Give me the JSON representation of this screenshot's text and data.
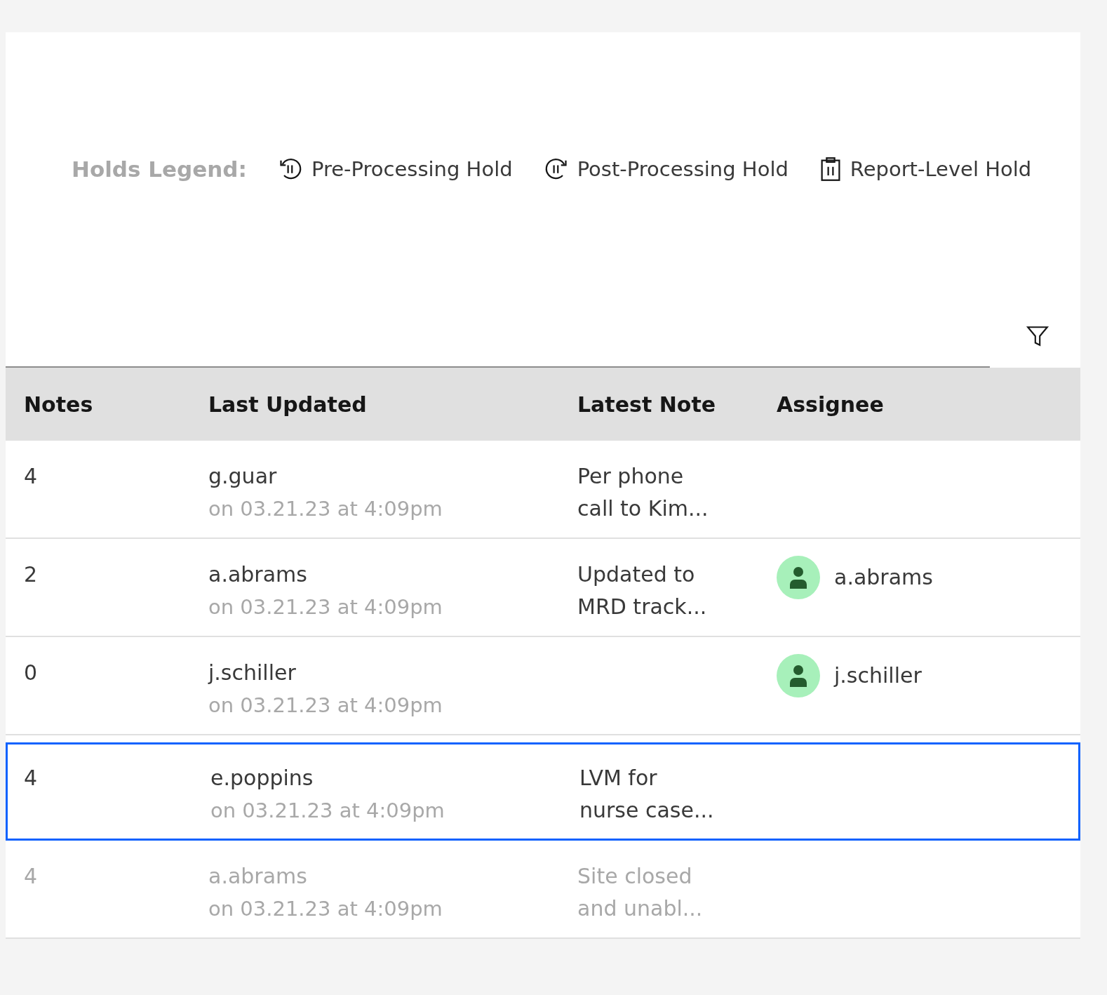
{
  "legend": {
    "title": "Holds Legend:",
    "items": [
      {
        "kind": "pre",
        "label": "Pre-Processing Hold"
      },
      {
        "kind": "post",
        "label": "Post-Processing Hold"
      },
      {
        "kind": "report",
        "label": "Report-Level Hold"
      }
    ]
  },
  "table": {
    "columns": [
      "Notes",
      "Last Updated",
      "Latest Note",
      "Assignee"
    ],
    "rows": [
      {
        "notes": "4",
        "user": "g.guar",
        "date": "on 03.21.23 at 4:09pm",
        "note": [
          "Per phone",
          "call to Kim..."
        ],
        "selected": false,
        "disabled": false
      },
      {
        "notes": "2",
        "user": "a.abrams",
        "date": "on 03.21.23 at 4:09pm",
        "note": [
          "Updated to",
          "MRD track..."
        ],
        "assignee": "a.abrams",
        "selected": false,
        "disabled": false
      },
      {
        "notes": "0",
        "user": "j.schiller",
        "date": "on 03.21.23 at 4:09pm",
        "assignee": "j.schiller",
        "selected": false,
        "disabled": false
      },
      {
        "notes": "4",
        "user": "e.poppins",
        "date": "on 03.21.23 at 4:09pm",
        "note": [
          "LVM for",
          "nurse case..."
        ],
        "selected": true,
        "disabled": false
      },
      {
        "notes": "4",
        "user": "a.abrams",
        "date": "on 03.21.23 at 4:09pm",
        "note": [
          "Site closed",
          "and unabl..."
        ],
        "selected": false,
        "disabled": true
      }
    ]
  }
}
